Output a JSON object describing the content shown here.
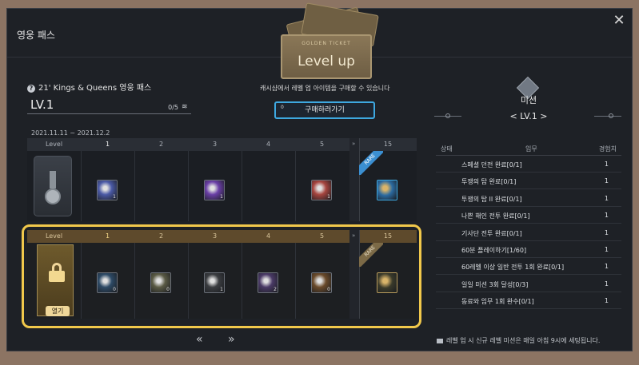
{
  "window": {
    "title": "영웅 패스",
    "close": "✕"
  },
  "ticket": {
    "small_text": "GOLDEN TICKET",
    "level_up": "Level up"
  },
  "buy": {
    "note": "캐시샵에서 레벨 업 아이템을 구매할 수 있습니다",
    "button_label": "구매하러가기",
    "button_icon_text": "0"
  },
  "pass": {
    "name": "21' Kings & Queens 영웅 패스",
    "level": "LV.1",
    "progress": "0/5",
    "date_range": "2021.11.11 ~ 2021.12.2"
  },
  "track": {
    "header_label": "Level",
    "columns": [
      "1",
      "2",
      "3",
      "4",
      "5"
    ],
    "final_level": "15",
    "rare_label": "RARE",
    "skip_glyph": "»"
  },
  "free_items": [
    {
      "col": 1,
      "qty": "1",
      "color": "#4b5aa6"
    },
    {
      "col": 3,
      "qty": "1",
      "color": "#6a3fa6"
    },
    {
      "col": 5,
      "qty": "1",
      "color": "#a6453f"
    }
  ],
  "final_free_item": {
    "qty": "",
    "color": "#2b6aa0"
  },
  "premium_items": [
    {
      "col": 1,
      "qty": "0",
      "color": "#2d4a66"
    },
    {
      "col": 2,
      "qty": "0",
      "color": "#5a5a44"
    },
    {
      "col": 3,
      "qty": "1",
      "color": "#3a3c40"
    },
    {
      "col": 4,
      "qty": "2",
      "color": "#4a3a66"
    },
    {
      "col": 5,
      "qty": "0",
      "color": "#6a4a2a"
    }
  ],
  "final_premium_item": {
    "qty": "",
    "color": "#3a3a2a"
  },
  "open_button": "열기",
  "pager": {
    "prev": "«",
    "next": "»"
  },
  "mission": {
    "title": "미션",
    "level": "< LV.1 >",
    "headers": {
      "status": "상태",
      "task": "임무",
      "exp": "경험치"
    },
    "rows": [
      {
        "task": "스페셜 던전 완료[0/1]",
        "exp": "1"
      },
      {
        "task": "투쟁의 탑 완료[0/1]",
        "exp": "1"
      },
      {
        "task": "투쟁의 탑 II 완료[0/1]",
        "exp": "1"
      },
      {
        "task": "나쁜 해인 전투 완료[0/1]",
        "exp": "1"
      },
      {
        "task": "기사단 전투 완료[0/1]",
        "exp": "1"
      },
      {
        "task": "60분 플레이하기[1/60]",
        "exp": "1"
      },
      {
        "task": "60레벨 이상 일반 전투 1회 완료[0/1]",
        "exp": "1"
      },
      {
        "task": "일일 미션 3회 달성[0/3]",
        "exp": "1"
      },
      {
        "task": "동료와 임무 1회 완수[0/1]",
        "exp": "1"
      }
    ],
    "note": "레벨 업 시 신규 레벨 미션은 매일 아침 9시에 세팅됩니다."
  }
}
